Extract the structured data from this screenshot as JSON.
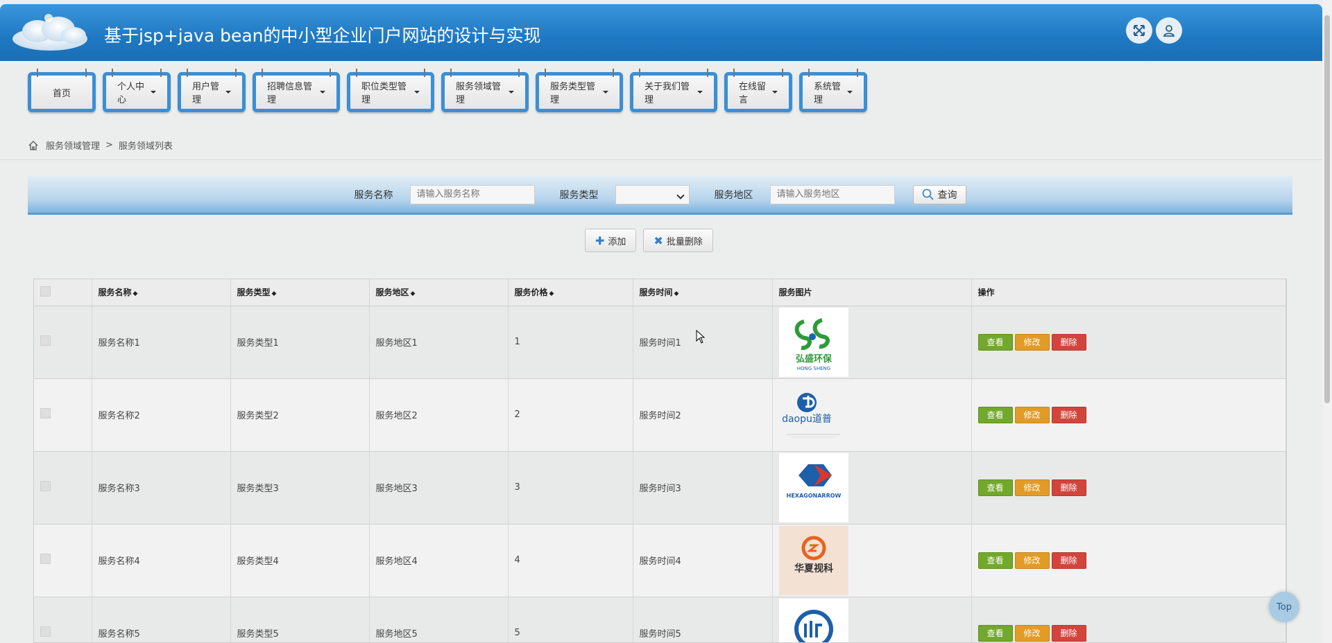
{
  "header": {
    "title": "基于jsp+java bean的中小型企业门户网站的设计与实现"
  },
  "nav": [
    {
      "label": "首页",
      "dropdown": false
    },
    {
      "label": "个人中心",
      "dropdown": true
    },
    {
      "label": "用户管理",
      "dropdown": true
    },
    {
      "label": "招聘信息管理",
      "dropdown": true
    },
    {
      "label": "职位类型管理",
      "dropdown": true
    },
    {
      "label": "服务领域管理",
      "dropdown": true
    },
    {
      "label": "服务类型管理",
      "dropdown": true
    },
    {
      "label": "关于我们管理",
      "dropdown": true
    },
    {
      "label": "在线留言",
      "dropdown": true
    },
    {
      "label": "系统管理",
      "dropdown": true
    }
  ],
  "breadcrumb": {
    "parent": "服务领域管理",
    "separator": ">",
    "current": "服务领域列表"
  },
  "search": {
    "name_label": "服务名称",
    "name_placeholder": "请输入服务名称",
    "type_label": "服务类型",
    "type_value": "",
    "region_label": "服务地区",
    "region_placeholder": "请输入服务地区",
    "query_label": "查询"
  },
  "actions": {
    "add_label": "添加",
    "batch_delete_label": "批量删除"
  },
  "table": {
    "headers": [
      "服务名称",
      "服务类型",
      "服务地区",
      "服务价格",
      "服务时间",
      "服务图片",
      "操作"
    ],
    "rows": [
      {
        "name": "服务名称1",
        "type": "服务类型1",
        "region": "服务地区1",
        "price": "1",
        "time": "服务时间1",
        "logo_text": "弘盛环保",
        "logo_sub": "HONG SHENG"
      },
      {
        "name": "服务名称2",
        "type": "服务类型2",
        "region": "服务地区2",
        "price": "2",
        "time": "服务时间2",
        "logo_text": "daopu道普",
        "logo_sub": ""
      },
      {
        "name": "服务名称3",
        "type": "服务类型3",
        "region": "服务地区3",
        "price": "3",
        "time": "服务时间3",
        "logo_text": "HEXAGONARROW",
        "logo_sub": ""
      },
      {
        "name": "服务名称4",
        "type": "服务类型4",
        "region": "服务地区4",
        "price": "4",
        "time": "服务时间4",
        "logo_text": "华夏视科",
        "logo_sub": ""
      },
      {
        "name": "服务名称5",
        "type": "服务类型5",
        "region": "服务地区5",
        "price": "5",
        "time": "服务时间5",
        "logo_text": "",
        "logo_sub": ""
      }
    ],
    "ops": {
      "view": "查看",
      "edit": "修改",
      "delete": "删除"
    }
  },
  "top_button": "Top"
}
